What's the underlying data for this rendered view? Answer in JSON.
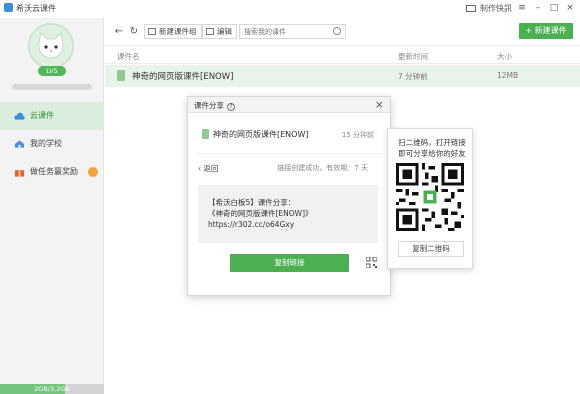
{
  "window": {
    "title": "希沃云课件",
    "action_label": "制作快訊"
  },
  "sidebar": {
    "level": "LV5",
    "items": [
      {
        "label": "云课件"
      },
      {
        "label": "我的学校"
      },
      {
        "label": "做任务赢奖励"
      }
    ],
    "storage_text": "2GB/3.2GB",
    "storage_used_fraction": 0.625
  },
  "toolbar": {
    "new_group_label": "新建课件组",
    "edit_label": "编辑",
    "search_placeholder": "搜索我的课件",
    "new_courseware_label": "新建课件"
  },
  "list": {
    "columns": [
      "课件名",
      "更新时间",
      "大小"
    ],
    "rows": [
      {
        "name": "神奇的网页版课件[ENOW]",
        "time": "7 分钟前",
        "size": "12MB"
      }
    ]
  },
  "share_dialog": {
    "title": "课件分享",
    "file_name": "神奇的网页版课件[ENOW]",
    "time": "15 分钟前",
    "back_label": "返回",
    "link_status": "链接创建成功，有效期：7 天",
    "share_line1": "【希沃白板5】课件分享：",
    "share_line2": "《神奇的网页版课件[ENOW]》",
    "share_line3": "https://r302.cc/o64Gxy",
    "copy_link_label": "复制链接"
  },
  "qr_panel": {
    "text_line1": "扫二维码，打开链接",
    "text_line2": "即可分享给你的好友",
    "copy_qr_label": "复制二维码"
  },
  "colors": {
    "accent": "#4cb052",
    "selected_row": "#e8f4e9",
    "sidebar_bg": "#f3f3f3"
  }
}
